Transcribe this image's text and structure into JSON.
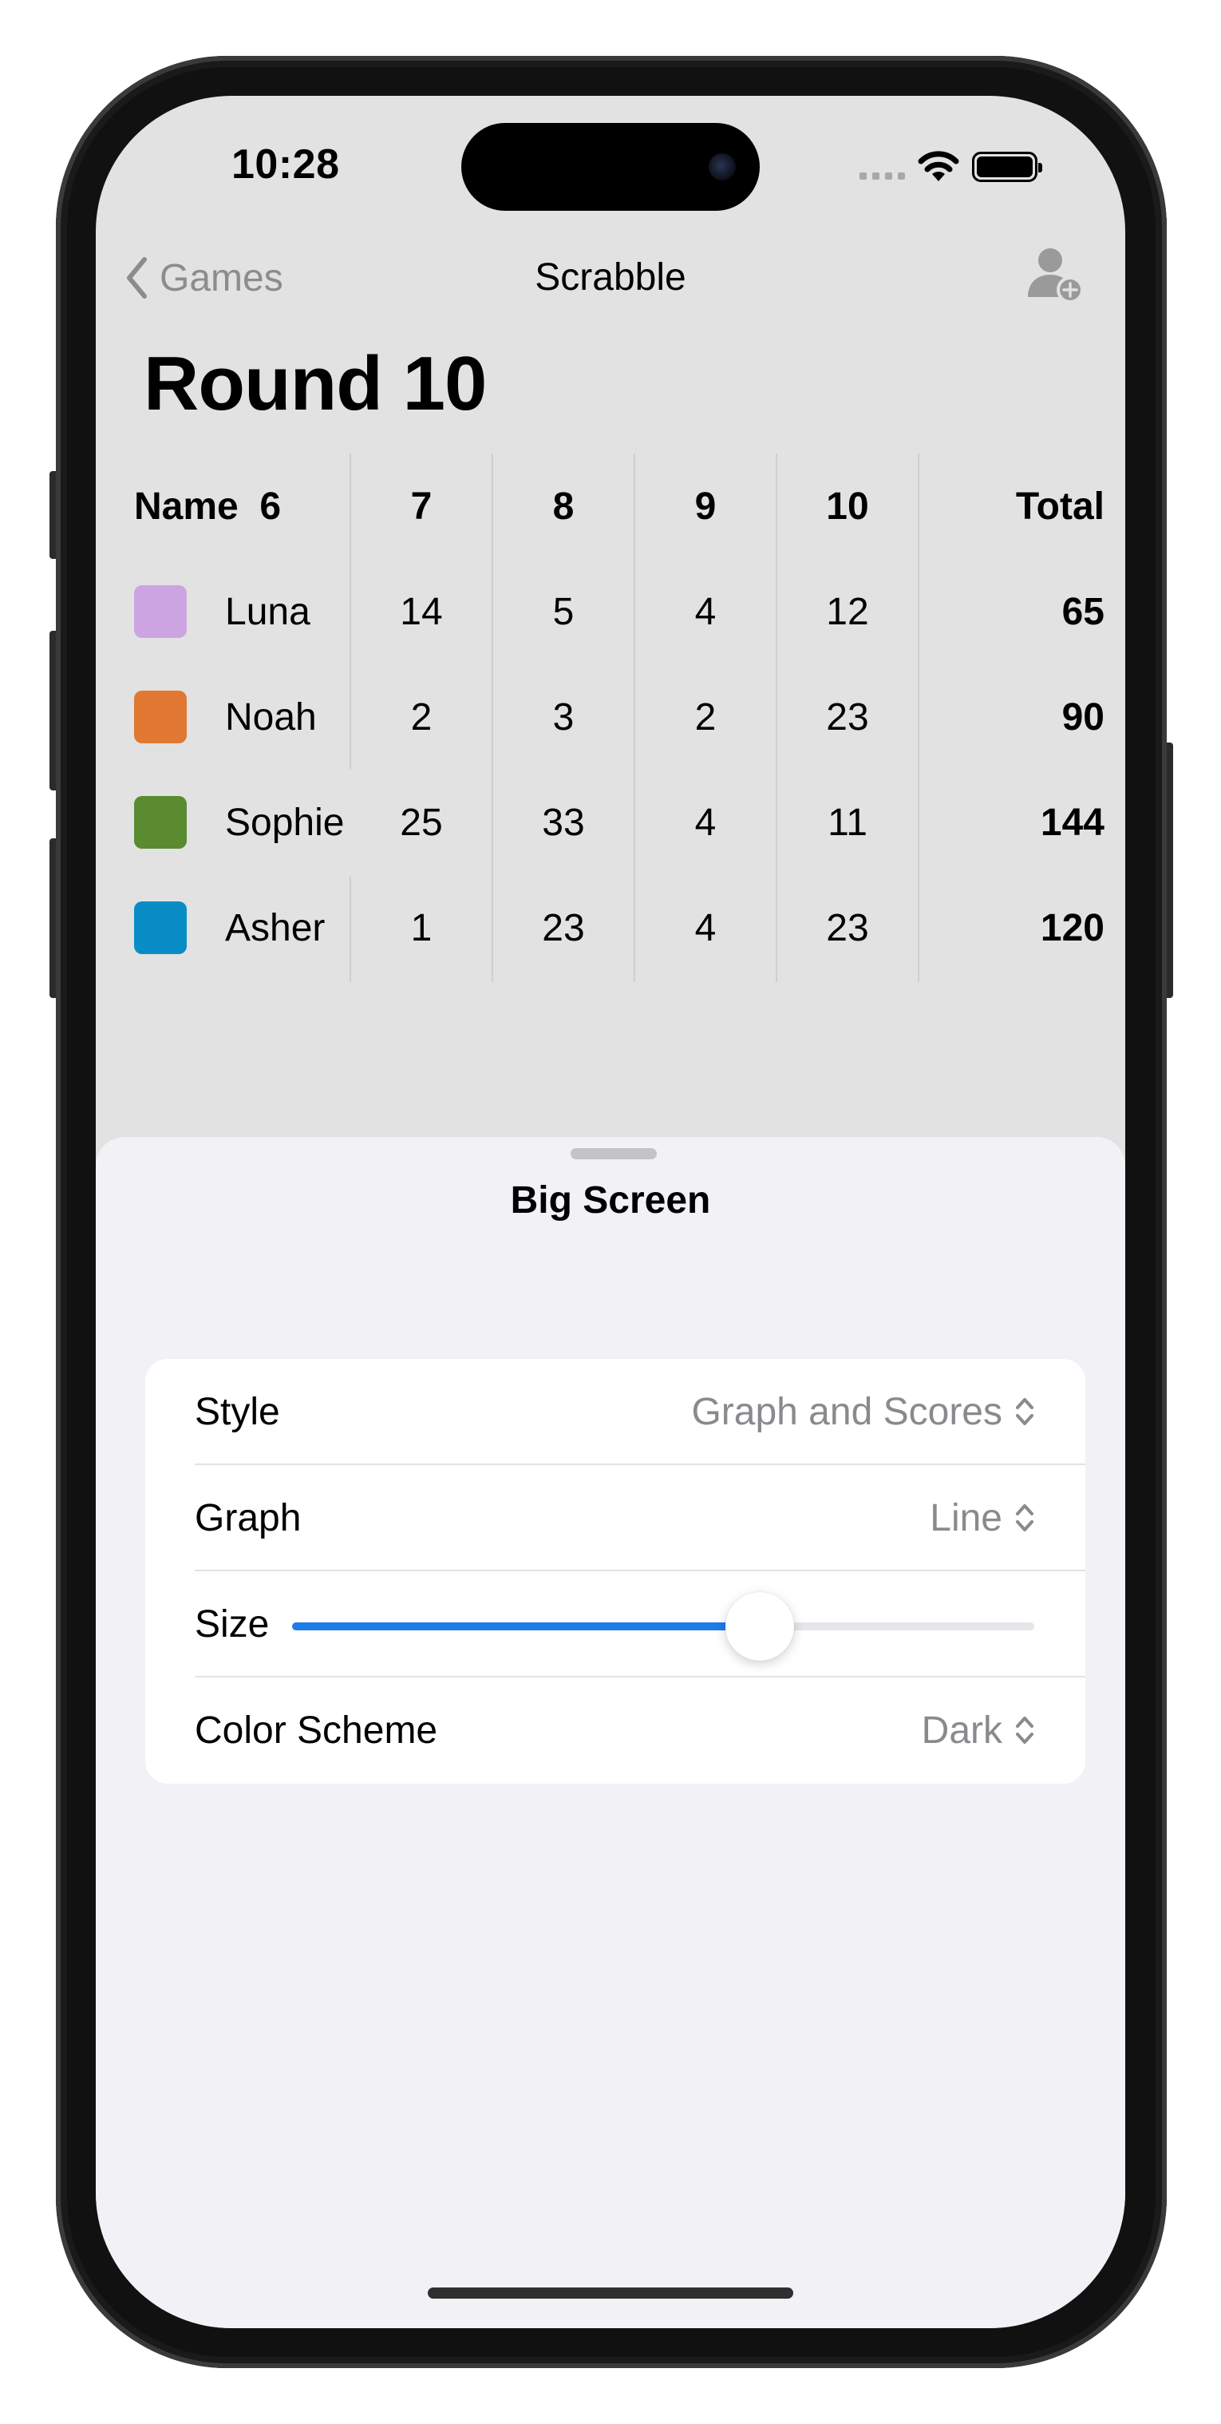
{
  "status_bar": {
    "time": "10:28"
  },
  "nav": {
    "back_label": "Games",
    "title": "Scrabble",
    "add_player_icon": "person-plus-icon"
  },
  "round_title": "Round 10",
  "score_table": {
    "headers": {
      "name": "Name",
      "rounds": [
        "6",
        "7",
        "8",
        "9",
        "10"
      ],
      "total": "Total"
    },
    "players": [
      {
        "name": "Luna",
        "color": "#cda4e2",
        "scores": [
          "14",
          "5",
          "4",
          "12"
        ],
        "total": "65"
      },
      {
        "name": "Noah",
        "color": "#e07832",
        "scores": [
          "2",
          "3",
          "2",
          "23"
        ],
        "total": "90"
      },
      {
        "name": "Sophie",
        "color": "#5a8b31",
        "scores": [
          "25",
          "33",
          "4",
          "11"
        ],
        "total": "144"
      },
      {
        "name": "Asher",
        "color": "#0a8cc6",
        "scores": [
          "1",
          "23",
          "4",
          "23"
        ],
        "total": "120"
      }
    ]
  },
  "sheet": {
    "title": "Big Screen",
    "settings": {
      "style": {
        "label": "Style",
        "value": "Graph and Scores"
      },
      "graph": {
        "label": "Graph",
        "value": "Line"
      },
      "size": {
        "label": "Size",
        "level_fraction": 0.63
      },
      "color_scheme": {
        "label": "Color Scheme",
        "value": "Dark"
      }
    }
  },
  "colors": {
    "accent": "#1f7bea",
    "secondary_text": "#8a8a8e",
    "sheet_bg": "#f2f2f6",
    "screen_bg": "#e2e2e2"
  }
}
